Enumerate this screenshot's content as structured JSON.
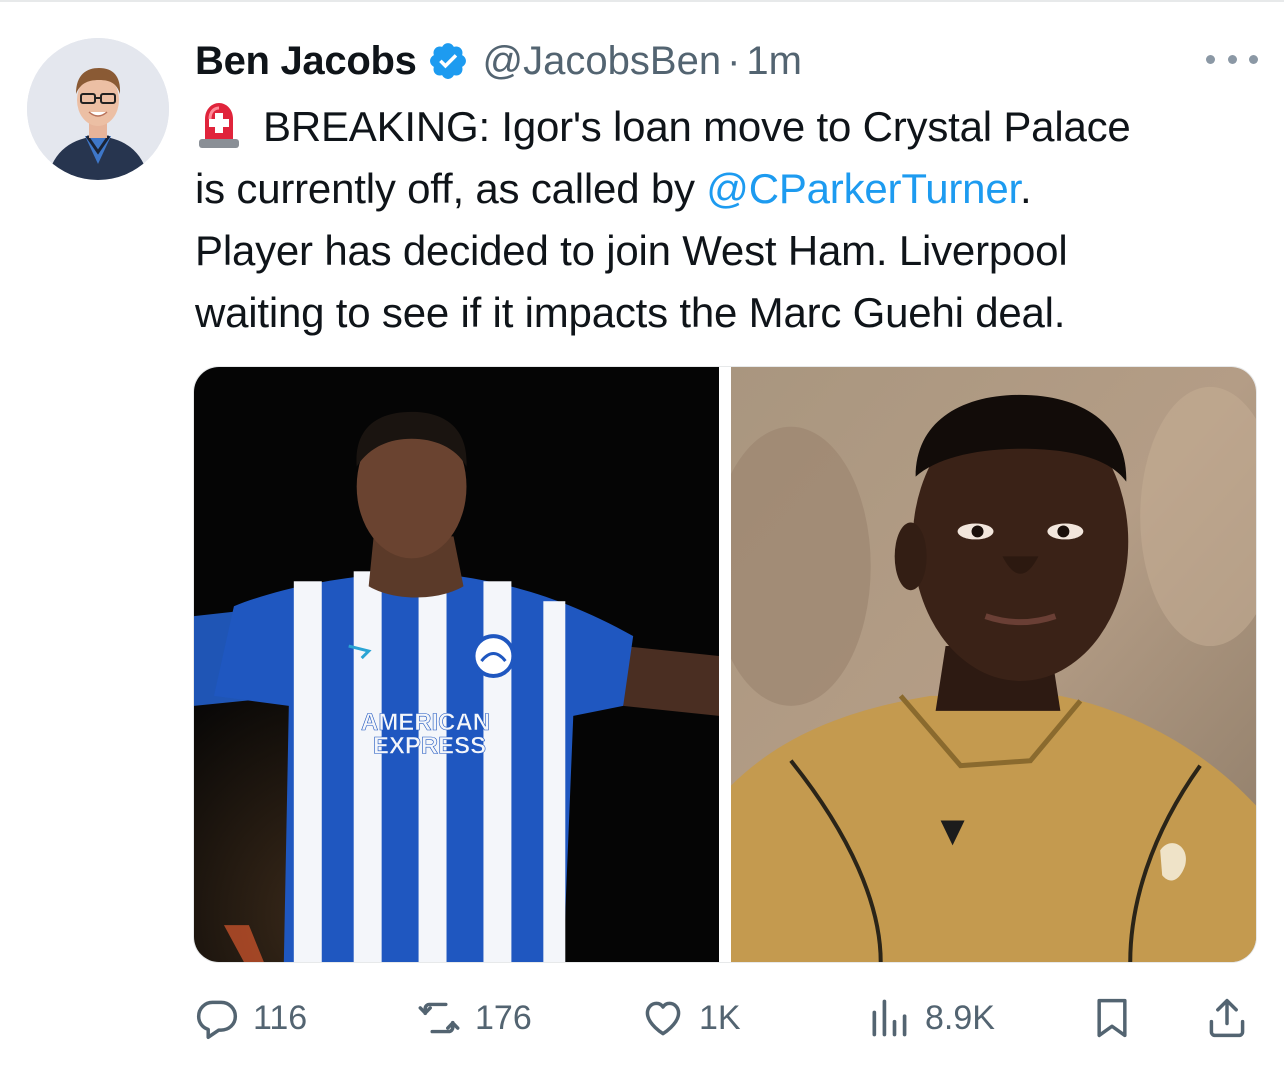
{
  "author": {
    "display_name": "Ben Jacobs",
    "handle": "@JacobsBen",
    "separator": "·",
    "timestamp": "1m",
    "verified": true
  },
  "tweet": {
    "lines": [
      {
        "emoji": "police-light-siren-icon",
        "text": "BREAKING: Igor's loan move to Crystal Palace"
      },
      {
        "before": "is currently off, as called by ",
        "mention": "@CParkerTurner",
        "after": "."
      },
      {
        "text": "Player has decided to join West Ham. Liverpool"
      },
      {
        "text": "waiting to see if it impacts the Marc Guehi deal."
      }
    ]
  },
  "media": {
    "left_photo": {
      "shirt_sponsor_line1": "AMERICAN",
      "shirt_sponsor_line2": "EXPRESS"
    },
    "right_photo": {}
  },
  "actions": {
    "replies": "116",
    "retweets": "176",
    "likes": "1K",
    "views": "8.9K"
  },
  "colors": {
    "link": "#1d9bf0",
    "secondary_text": "#536471",
    "verified_badge": "#1d9bf0"
  }
}
